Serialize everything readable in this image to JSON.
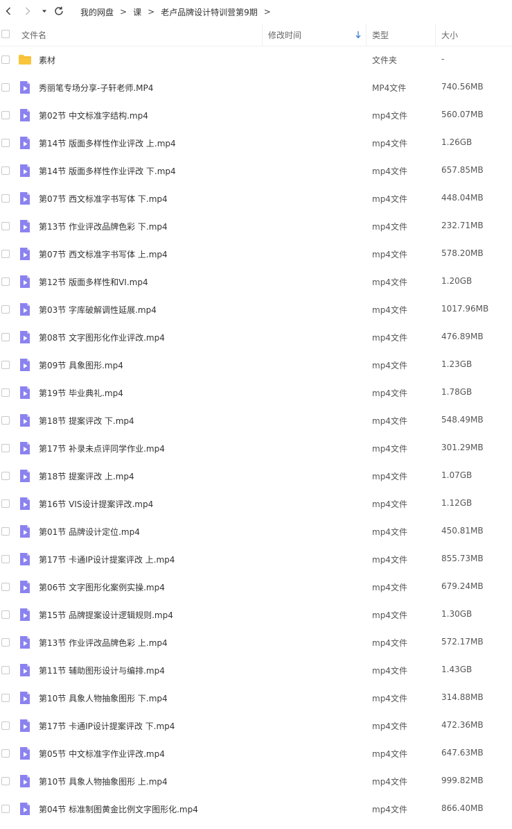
{
  "nav": {
    "back_icon": "chevron-left-icon",
    "forward_icon": "chevron-right-icon",
    "dropdown_icon": "caret-down-icon",
    "refresh_icon": "refresh-icon"
  },
  "breadcrumb": {
    "items": [
      "我的网盘",
      "课",
      "老卢品牌设计特训营第9期"
    ],
    "separator": ">"
  },
  "columns": {
    "name": "文件名",
    "modified": "修改时间",
    "type": "类型",
    "size": "大小"
  },
  "colors": {
    "folder": "#f9c53c",
    "video": "#8b82f0",
    "text": "#333333"
  },
  "files": [
    {
      "icon": "folder-icon",
      "name": "素材",
      "type": "文件夹",
      "size": "-"
    },
    {
      "icon": "video-icon",
      "name": "秀丽笔专场分享-子轩老师.MP4",
      "type": "MP4文件",
      "size": "740.56MB"
    },
    {
      "icon": "video-icon",
      "name": "第02节 中文标准字结构.mp4",
      "type": "mp4文件",
      "size": "560.07MB"
    },
    {
      "icon": "video-icon",
      "name": "第14节 版面多样性作业评改 上.mp4",
      "type": "mp4文件",
      "size": "1.26GB"
    },
    {
      "icon": "video-icon",
      "name": "第14节 版面多样性作业评改 下.mp4",
      "type": "mp4文件",
      "size": "657.85MB"
    },
    {
      "icon": "video-icon",
      "name": "第07节 西文标准字书写体 下.mp4",
      "type": "mp4文件",
      "size": "448.04MB"
    },
    {
      "icon": "video-icon",
      "name": "第13节 作业评改品牌色彩 下.mp4",
      "type": "mp4文件",
      "size": "232.71MB"
    },
    {
      "icon": "video-icon",
      "name": "第07节 西文标准字书写体 上.mp4",
      "type": "mp4文件",
      "size": "578.20MB"
    },
    {
      "icon": "video-icon",
      "name": "第12节 版面多样性和VI.mp4",
      "type": "mp4文件",
      "size": "1.20GB"
    },
    {
      "icon": "video-icon",
      "name": "第03节 字库破解调性延展.mp4",
      "type": "mp4文件",
      "size": "1017.96MB"
    },
    {
      "icon": "video-icon",
      "name": "第08节 文字图形化作业评改.mp4",
      "type": "mp4文件",
      "size": "476.89MB"
    },
    {
      "icon": "video-icon",
      "name": "第09节 具象图形.mp4",
      "type": "mp4文件",
      "size": "1.23GB"
    },
    {
      "icon": "video-icon",
      "name": "第19节 毕业典礼.mp4",
      "type": "mp4文件",
      "size": "1.78GB"
    },
    {
      "icon": "video-icon",
      "name": "第18节 提案评改 下.mp4",
      "type": "mp4文件",
      "size": "548.49MB"
    },
    {
      "icon": "video-icon",
      "name": "第17节 补录未点评同学作业.mp4",
      "type": "mp4文件",
      "size": "301.29MB"
    },
    {
      "icon": "video-icon",
      "name": "第18节 提案评改 上.mp4",
      "type": "mp4文件",
      "size": "1.07GB"
    },
    {
      "icon": "video-icon",
      "name": "第16节 VIS设计提案评改.mp4",
      "type": "mp4文件",
      "size": "1.12GB"
    },
    {
      "icon": "video-icon",
      "name": "第01节 品牌设计定位.mp4",
      "type": "mp4文件",
      "size": "450.81MB"
    },
    {
      "icon": "video-icon",
      "name": "第17节 卡通IP设计提案评改 上.mp4",
      "type": "mp4文件",
      "size": "855.73MB"
    },
    {
      "icon": "video-icon",
      "name": "第06节 文字图形化案例实操.mp4",
      "type": "mp4文件",
      "size": "679.24MB"
    },
    {
      "icon": "video-icon",
      "name": "第15节 品牌提案设计逻辑规则.mp4",
      "type": "mp4文件",
      "size": "1.30GB"
    },
    {
      "icon": "video-icon",
      "name": "第13节 作业评改品牌色彩 上.mp4",
      "type": "mp4文件",
      "size": "572.17MB"
    },
    {
      "icon": "video-icon",
      "name": "第11节 辅助图形设计与编排.mp4",
      "type": "mp4文件",
      "size": "1.43GB"
    },
    {
      "icon": "video-icon",
      "name": "第10节 具象人物抽象图形 下.mp4",
      "type": "mp4文件",
      "size": "314.88MB"
    },
    {
      "icon": "video-icon",
      "name": "第17节 卡通IP设计提案评改 下.mp4",
      "type": "mp4文件",
      "size": "472.36MB"
    },
    {
      "icon": "video-icon",
      "name": "第05节 中文标准字作业评改.mp4",
      "type": "mp4文件",
      "size": "647.63MB"
    },
    {
      "icon": "video-icon",
      "name": "第10节 具象人物抽象图形 上.mp4",
      "type": "mp4文件",
      "size": "999.82MB"
    },
    {
      "icon": "video-icon",
      "name": "第04节 标准制图黄金比例文字图形化.mp4",
      "type": "mp4文件",
      "size": "866.40MB"
    }
  ]
}
